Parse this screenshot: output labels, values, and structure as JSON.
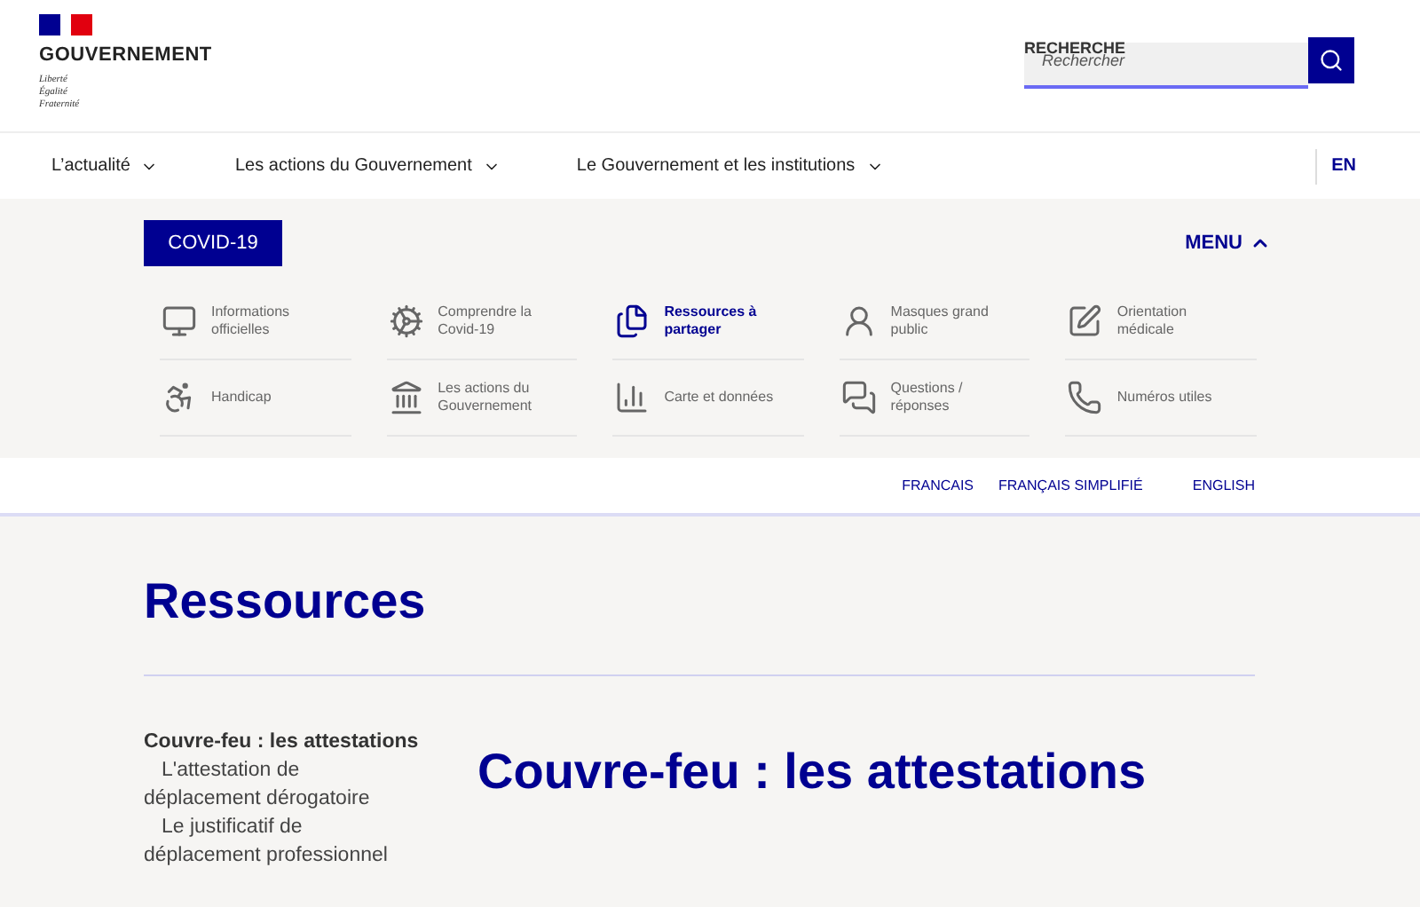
{
  "header": {
    "brand": "GOUVERNEMENT",
    "motto": [
      "Liberté",
      "Égalité",
      "Fraternité"
    ],
    "search": {
      "label": "RECHERCHE",
      "placeholder": "Rechercher"
    }
  },
  "nav": {
    "items": [
      "L’actualité",
      "Les actions du Gouvernement",
      "Le Gouvernement et les institutions"
    ],
    "language": "EN"
  },
  "covid": {
    "badge": "COVID-19",
    "menu": "MENU",
    "menu_expanded": true,
    "items": [
      {
        "label": "Informations officielles",
        "selected": false
      },
      {
        "label": "Comprendre la Covid-19",
        "selected": false
      },
      {
        "label": "Ressources à partager",
        "selected": true
      },
      {
        "label": "Masques grand public",
        "selected": false
      },
      {
        "label": "Orientation médicale",
        "selected": false
      },
      {
        "label": "Handicap",
        "selected": false
      },
      {
        "label": "Les actions du Gouvernement",
        "selected": false
      },
      {
        "label": "Carte et données",
        "selected": false
      },
      {
        "label": "Questions / réponses",
        "selected": false
      },
      {
        "label": "Numéros utiles",
        "selected": false
      }
    ]
  },
  "languages": [
    "FRANCAIS",
    "FRANÇAIS SIMPLIFIÉ",
    "ENGLISH"
  ],
  "page": {
    "title": "Ressources",
    "heading": "Couvre-feu : les attestations",
    "outline": [
      {
        "label": "Couvre-feu : les attestations",
        "children": [
          {
            "label": "L'attestation de déplacement dérogatoire"
          },
          {
            "label": "Le justificatif de déplacement professionnel"
          }
        ]
      }
    ]
  }
}
